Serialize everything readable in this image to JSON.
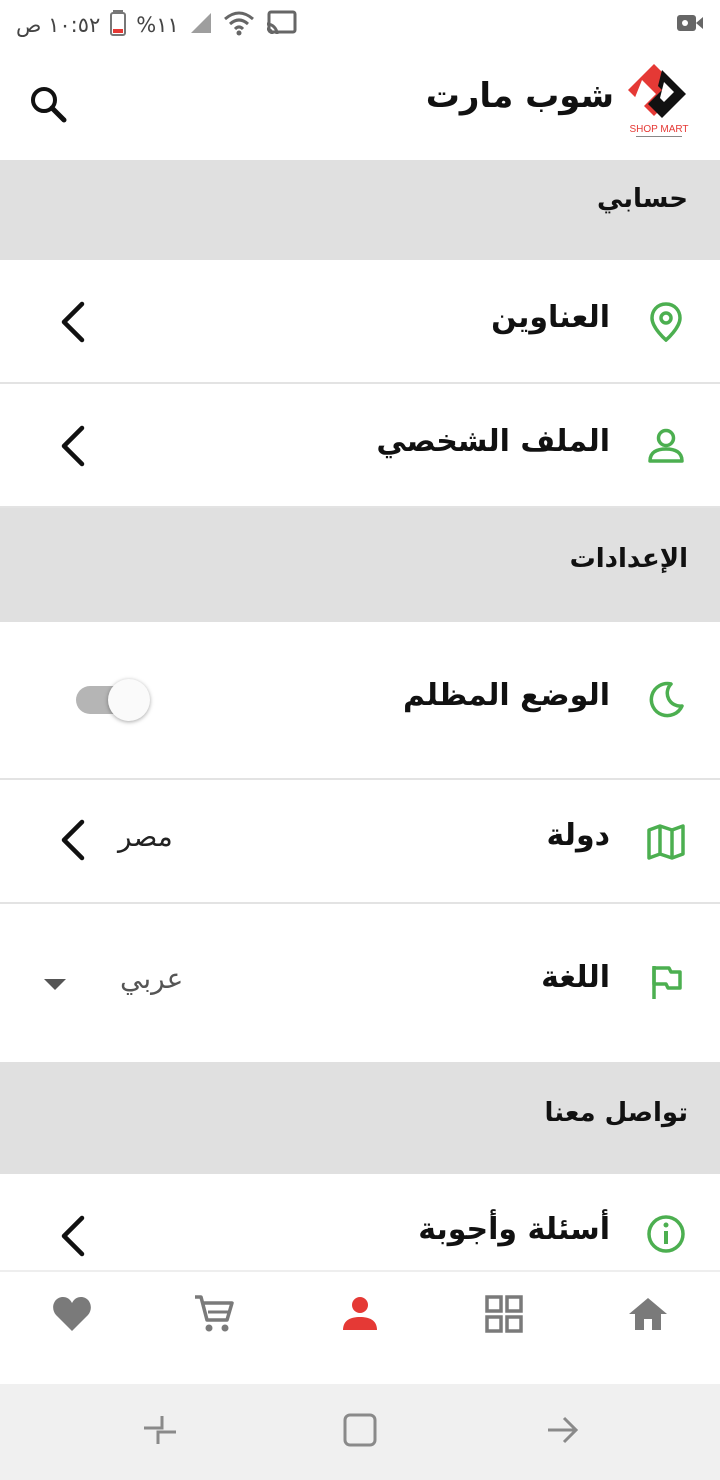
{
  "status_bar": {
    "time": "١٠:٥٢ ص",
    "battery": "%١١",
    "icons": [
      "battery-icon",
      "signal-icon",
      "wifi-icon",
      "cast-icon",
      "video-record-icon"
    ]
  },
  "app_bar": {
    "title": "شوب مارت",
    "logo_text": "SHOP MART",
    "search_icon": "search-icon"
  },
  "sections": {
    "account": {
      "title": "حسابي"
    },
    "settings": {
      "title": "الإعدادات"
    },
    "contact": {
      "title": "تواصل معنا"
    }
  },
  "rows": {
    "addresses": {
      "label": "العناوين",
      "icon": "location-pin-icon"
    },
    "profile": {
      "label": "الملف الشخصي",
      "icon": "person-outline-icon"
    },
    "dark_mode": {
      "label": "الوضع المظلم",
      "icon": "moon-icon",
      "enabled": true
    },
    "country": {
      "label": "دولة",
      "value": "مصر",
      "icon": "map-icon"
    },
    "language": {
      "label": "اللغة",
      "value": "عربي",
      "icon": "flag-icon"
    },
    "faq": {
      "label": "أسئلة وأجوبة",
      "icon": "info-icon"
    }
  },
  "colors": {
    "accent_green": "#4caf50",
    "active_red": "#e53935",
    "inactive_gray": "#7a7a7a",
    "section_bg": "#e0e0e0"
  },
  "bottom_nav": {
    "items": [
      "heart-icon",
      "cart-icon",
      "person-icon",
      "grid-icon",
      "home-icon"
    ],
    "active": "person-icon"
  }
}
